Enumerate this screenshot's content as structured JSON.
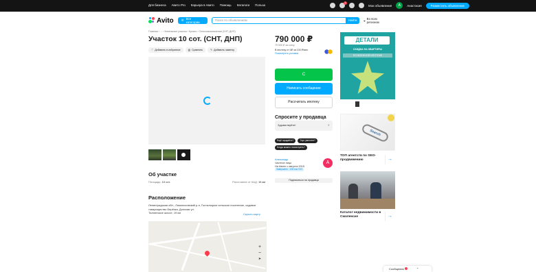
{
  "topbar": {
    "links": [
      "Для бизнеса",
      "Карьера в Авито",
      "Помощь",
      "Каталоги",
      "Польза"
    ],
    "links_extra": "Авито Pro",
    "messages_label": "Мои объявления",
    "user_initial": "А",
    "user_name": "Анастасия",
    "post_button": "Разместить объявление",
    "badge_count": "1"
  },
  "header": {
    "logo": "Avito",
    "categories_button": "Все категории",
    "search_placeholder": "Поиск по объявлениям",
    "search_button": "Найти",
    "region": "Во всех регионах"
  },
  "listing": {
    "breadcrumbs": "Главная › ... › Земельные участки › Купить › Сельхозназначения (СНТ, ДНП)",
    "title": "Участок 10 сот. (СНТ, ДНП)",
    "actions": [
      "Добавить в избранное",
      "Сравнить",
      "Добавить заметку"
    ],
    "price": "790 000 ₽",
    "price_per": "79 000 ₽ за сотку",
    "mortgage_text": "В ипотеку от 0₽ за 100 ₽/мес",
    "mortgage_link": "Посмотреть условия",
    "btn_phone": "С",
    "btn_message": "Написать сообщение",
    "btn_mortgage": "Рассчитать ипотеку"
  },
  "ask": {
    "title": "Спросите у продавца",
    "input_value": "Здравствуйте!",
    "quick_questions": [
      "Ещё продаёте?",
      "Торг уместен?",
      "Когда можно посмотреть?"
    ]
  },
  "seller": {
    "name": "Александр",
    "type": "Частное лицо",
    "since": "На Авито с августа 2015",
    "rating": "Завершено · 128 тыс+ОО",
    "initial": "А",
    "subscribe": "Подписаться на продавца"
  },
  "about": {
    "heading": "Об участке",
    "area_label": "Площадь:",
    "area_value": "10 сот.",
    "distance_label": "Расстояние от КАД:",
    "distance_value": "19 км"
  },
  "location": {
    "heading": "Расположение",
    "address": "Ленинградская обл., Ломоносовский р-н, Гостилицкое сельское поселение, садовое товарищество Берёзка, Донская ул.",
    "highway": "Таллинское шоссе, 19 км",
    "hide_map": "Скрыть карту"
  },
  "ads": {
    "ad1_brand": "ДЕТАЛИ",
    "ad1_line1": "СКИДКА НА КВАРТИРЫ",
    "ad1_line2": "ПО ВОЕННОЙ ИПОТЕКЕ",
    "ad2_word": "Search",
    "ad2_caption": "ТОП агентств по SEO-продвижению",
    "ad3_caption": "Каталог недвижимости в Смоленске"
  },
  "chat": {
    "label": "Сообщения"
  }
}
